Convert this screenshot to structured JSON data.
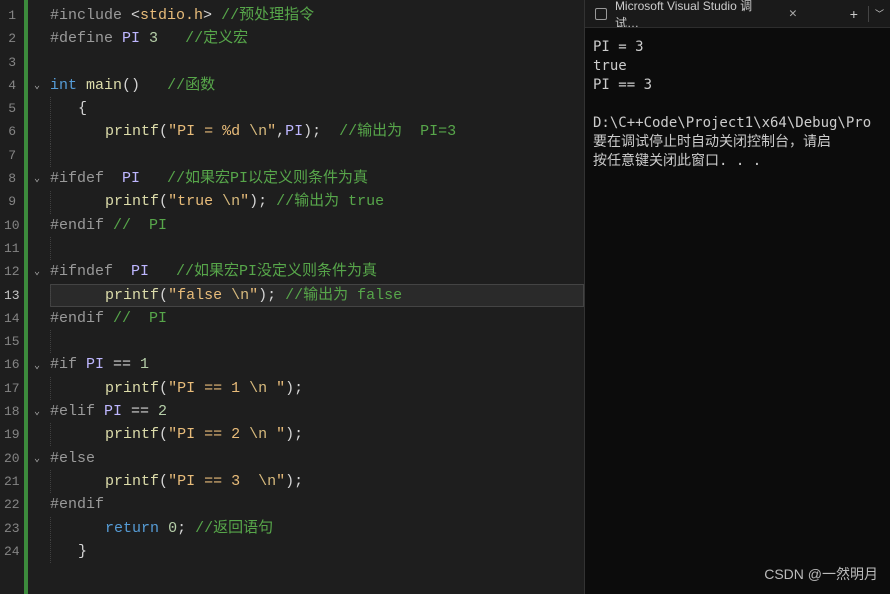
{
  "editor": {
    "activeLine": 13,
    "lines": [
      {
        "n": 1,
        "tokens": [
          {
            "t": "#include ",
            "c": "tk-pp"
          },
          {
            "t": "<",
            "c": "tk-op"
          },
          {
            "t": "stdio.h",
            "c": "tk-str"
          },
          {
            "t": ">",
            "c": "tk-op"
          },
          {
            "t": " ",
            "c": ""
          },
          {
            "t": "//预处理指令",
            "c": "tk-cmt"
          }
        ]
      },
      {
        "n": 2,
        "tokens": [
          {
            "t": "#define ",
            "c": "tk-pp"
          },
          {
            "t": "PI",
            "c": "tk-def"
          },
          {
            "t": " ",
            "c": ""
          },
          {
            "t": "3",
            "c": "tk-num"
          },
          {
            "t": "   ",
            "c": ""
          },
          {
            "t": "//定义宏",
            "c": "tk-cmt"
          }
        ]
      },
      {
        "n": 3,
        "tokens": []
      },
      {
        "n": 4,
        "fold": true,
        "tokens": [
          {
            "t": "int",
            "c": "tk-kw"
          },
          {
            "t": " ",
            "c": ""
          },
          {
            "t": "main",
            "c": "tk-fn"
          },
          {
            "t": "()",
            "c": "tk-br"
          },
          {
            "t": "   ",
            "c": ""
          },
          {
            "t": "//函数",
            "c": "tk-cmt"
          }
        ]
      },
      {
        "n": 5,
        "indent": 1,
        "tokens": [
          {
            "t": "{",
            "c": "tk-br"
          }
        ]
      },
      {
        "n": 6,
        "indent": 1,
        "tokens": [
          {
            "t": "   ",
            "c": ""
          },
          {
            "t": "printf",
            "c": "tk-fn"
          },
          {
            "t": "(",
            "c": "tk-br"
          },
          {
            "t": "\"PI = %d ",
            "c": "tk-str"
          },
          {
            "t": "\\n",
            "c": "tk-esc"
          },
          {
            "t": "\"",
            "c": "tk-str"
          },
          {
            "t": ",",
            "c": "tk-op"
          },
          {
            "t": "PI",
            "c": "tk-def"
          },
          {
            "t": ");",
            "c": "tk-br"
          },
          {
            "t": "  ",
            "c": ""
          },
          {
            "t": "//输出为  PI=3",
            "c": "tk-cmt"
          }
        ]
      },
      {
        "n": 7,
        "indent": 1,
        "tokens": []
      },
      {
        "n": 8,
        "fold": true,
        "indent": 0,
        "tokens": [
          {
            "t": "#ifdef  ",
            "c": "tk-pp"
          },
          {
            "t": "PI",
            "c": "tk-def"
          },
          {
            "t": "   ",
            "c": ""
          },
          {
            "t": "//如果宏PI以定义则条件为真",
            "c": "tk-cmt"
          }
        ]
      },
      {
        "n": 9,
        "indent": 1,
        "tokens": [
          {
            "t": "   ",
            "c": ""
          },
          {
            "t": "printf",
            "c": "tk-fn"
          },
          {
            "t": "(",
            "c": "tk-br"
          },
          {
            "t": "\"true ",
            "c": "tk-str"
          },
          {
            "t": "\\n",
            "c": "tk-esc"
          },
          {
            "t": "\"",
            "c": "tk-str"
          },
          {
            "t": ");",
            "c": "tk-br"
          },
          {
            "t": " ",
            "c": ""
          },
          {
            "t": "//输出为 true",
            "c": "tk-cmt"
          }
        ]
      },
      {
        "n": 10,
        "tokens": [
          {
            "t": "#endif ",
            "c": "tk-pp"
          },
          {
            "t": "//  PI",
            "c": "tk-cmt"
          }
        ]
      },
      {
        "n": 11,
        "indent": 1,
        "tokens": []
      },
      {
        "n": 12,
        "fold": true,
        "tokens": [
          {
            "t": "#ifndef  ",
            "c": "tk-pp"
          },
          {
            "t": "PI",
            "c": "tk-def"
          },
          {
            "t": "   ",
            "c": ""
          },
          {
            "t": "//如果宏PI没定义则条件为真",
            "c": "tk-cmt"
          }
        ]
      },
      {
        "n": 13,
        "indent": 1,
        "tokens": [
          {
            "t": "   ",
            "c": ""
          },
          {
            "t": "printf",
            "c": "tk-fn"
          },
          {
            "t": "(",
            "c": "tk-br"
          },
          {
            "t": "\"false ",
            "c": "tk-str"
          },
          {
            "t": "\\n",
            "c": "tk-esc"
          },
          {
            "t": "\"",
            "c": "tk-str"
          },
          {
            "t": ");",
            "c": "tk-br"
          },
          {
            "t": " ",
            "c": ""
          },
          {
            "t": "//输出为 false",
            "c": "tk-cmt"
          }
        ]
      },
      {
        "n": 14,
        "tokens": [
          {
            "t": "#endif ",
            "c": "tk-pp"
          },
          {
            "t": "//  PI",
            "c": "tk-cmt"
          }
        ]
      },
      {
        "n": 15,
        "indent": 1,
        "tokens": []
      },
      {
        "n": 16,
        "fold": true,
        "tokens": [
          {
            "t": "#if ",
            "c": "tk-pp"
          },
          {
            "t": "PI",
            "c": "tk-def"
          },
          {
            "t": " == ",
            "c": "tk-op"
          },
          {
            "t": "1",
            "c": "tk-num"
          }
        ]
      },
      {
        "n": 17,
        "indent": 1,
        "tokens": [
          {
            "t": "   ",
            "c": ""
          },
          {
            "t": "printf",
            "c": "tk-fn"
          },
          {
            "t": "(",
            "c": "tk-br"
          },
          {
            "t": "\"PI == 1 ",
            "c": "tk-str"
          },
          {
            "t": "\\n",
            "c": "tk-esc"
          },
          {
            "t": " \"",
            "c": "tk-str"
          },
          {
            "t": ");",
            "c": "tk-br"
          }
        ]
      },
      {
        "n": 18,
        "fold": true,
        "tokens": [
          {
            "t": "#elif ",
            "c": "tk-pp"
          },
          {
            "t": "PI",
            "c": "tk-def"
          },
          {
            "t": " == ",
            "c": "tk-op"
          },
          {
            "t": "2",
            "c": "tk-num"
          }
        ]
      },
      {
        "n": 19,
        "indent": 1,
        "tokens": [
          {
            "t": "   ",
            "c": ""
          },
          {
            "t": "printf",
            "c": "tk-fn"
          },
          {
            "t": "(",
            "c": "tk-br"
          },
          {
            "t": "\"PI == 2 ",
            "c": "tk-str"
          },
          {
            "t": "\\n",
            "c": "tk-esc"
          },
          {
            "t": " \"",
            "c": "tk-str"
          },
          {
            "t": ");",
            "c": "tk-br"
          }
        ]
      },
      {
        "n": 20,
        "fold": true,
        "tokens": [
          {
            "t": "#else",
            "c": "tk-pp"
          }
        ]
      },
      {
        "n": 21,
        "indent": 1,
        "tokens": [
          {
            "t": "   ",
            "c": ""
          },
          {
            "t": "printf",
            "c": "tk-fn"
          },
          {
            "t": "(",
            "c": "tk-br"
          },
          {
            "t": "\"PI == 3  ",
            "c": "tk-str"
          },
          {
            "t": "\\n",
            "c": "tk-esc"
          },
          {
            "t": "\"",
            "c": "tk-str"
          },
          {
            "t": ");",
            "c": "tk-br"
          }
        ]
      },
      {
        "n": 22,
        "tokens": [
          {
            "t": "#endif",
            "c": "tk-pp"
          }
        ]
      },
      {
        "n": 23,
        "indent": 1,
        "tokens": [
          {
            "t": "   ",
            "c": ""
          },
          {
            "t": "return",
            "c": "tk-kw"
          },
          {
            "t": " ",
            "c": ""
          },
          {
            "t": "0",
            "c": "tk-num"
          },
          {
            "t": ";",
            "c": "tk-op"
          },
          {
            "t": " ",
            "c": ""
          },
          {
            "t": "//返回语句",
            "c": "tk-cmt"
          }
        ]
      },
      {
        "n": 24,
        "indent": 1,
        "tokens": [
          {
            "t": "}",
            "c": "tk-br"
          }
        ]
      }
    ]
  },
  "terminal": {
    "tabTitle": "Microsoft Visual Studio 调试…",
    "output": "PI = 3\ntrue\nPI == 3\n\nD:\\C++Code\\Project1\\x64\\Debug\\Pro\n要在调试停止时自动关闭控制台，请启\n按任意键关闭此窗口. . ."
  },
  "watermark": "CSDN @一然明月"
}
